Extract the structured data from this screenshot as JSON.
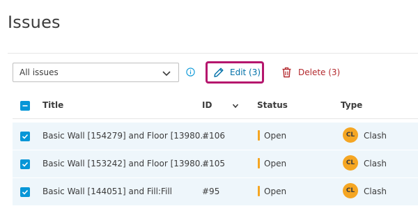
{
  "page": {
    "title": "Issues"
  },
  "toolbar": {
    "filter_value": "All issues",
    "edit_label": "Edit (3)",
    "delete_label": "Delete (3)"
  },
  "table": {
    "columns": [
      "Title",
      "ID",
      "Status",
      "Type"
    ],
    "rows": [
      {
        "title": "Basic Wall [154279] and Floor [13980…",
        "id": "#106",
        "status": "Open",
        "type_initials": "CL",
        "type": "Clash"
      },
      {
        "title": "Basic Wall [153242] and Floor [13980…",
        "id": "#105",
        "status": "Open",
        "type_initials": "CL",
        "type": "Clash"
      },
      {
        "title": "Basic Wall [144051] and Fill:Fill",
        "id": "#95",
        "status": "Open",
        "type_initials": "CL",
        "type": "Clash"
      }
    ]
  },
  "colors": {
    "accent_blue": "#0696d7",
    "highlight_border": "#b5166d",
    "delete_red": "#b3282d",
    "status_open": "#f5a623",
    "row_selected_bg": "#eef6fb"
  },
  "icons": {
    "filter": "chevron-down-icon",
    "info": "info-icon",
    "edit": "pencil-icon",
    "delete": "trash-icon",
    "header_checkbox": "indeterminate-checkbox-icon",
    "row_checkbox": "checkmark-icon",
    "sort": "chevron-down-icon"
  }
}
